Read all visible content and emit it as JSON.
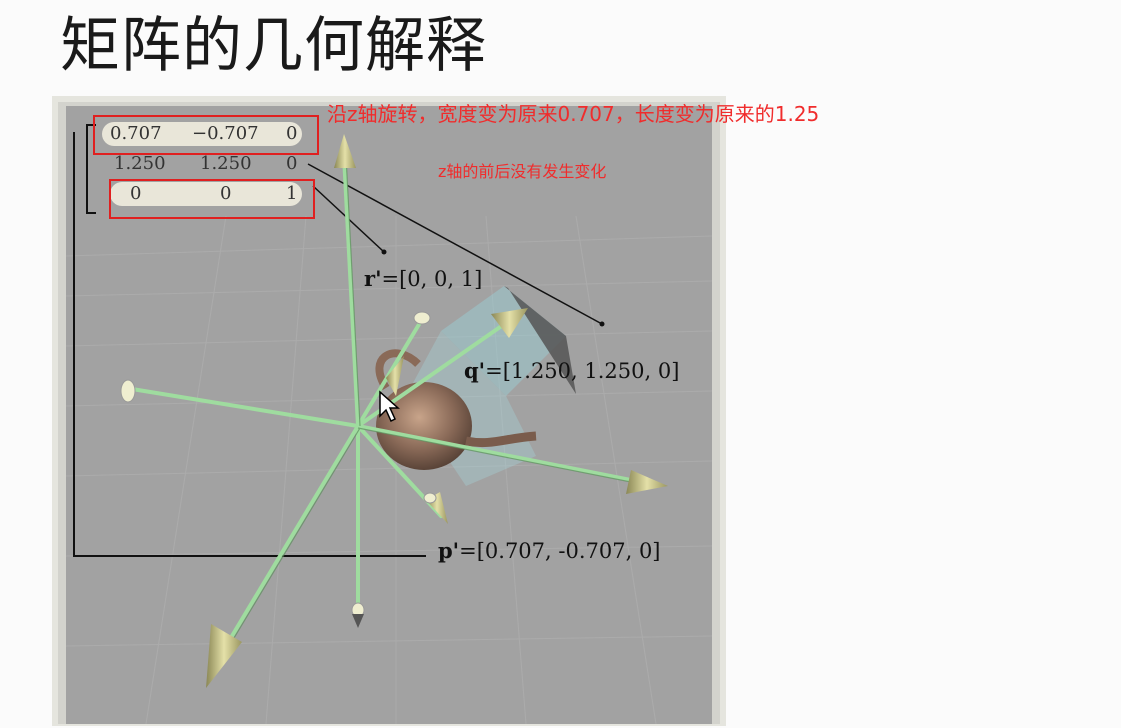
{
  "title": "矩阵的几何解释",
  "matrix": {
    "rows": [
      [
        "0.707",
        "−0.707",
        "0"
      ],
      [
        "1.250",
        "1.250",
        "0"
      ],
      [
        "0",
        "0",
        "1"
      ]
    ]
  },
  "vectors": {
    "r": {
      "name": "r'",
      "value": "=[0, 0, 1]"
    },
    "q": {
      "name": "q'",
      "value": "=[1.250, 1.250, 0]"
    },
    "p": {
      "name": "p'",
      "value": "=[0.707, -0.707, 0]"
    }
  },
  "annotations": {
    "top_note": "沿z轴旋转，宽度变为原来0.707，长度变为原来的1.25",
    "z_note": "z轴的前后没有发生变化"
  },
  "colors": {
    "annotation_red": "#f02c2c",
    "axis_green": "#9fdc9f",
    "arrow_cone": "#d8d49a",
    "viewport_gray": "#a2a2a2"
  },
  "icons": [
    "mouse-cursor-icon"
  ]
}
